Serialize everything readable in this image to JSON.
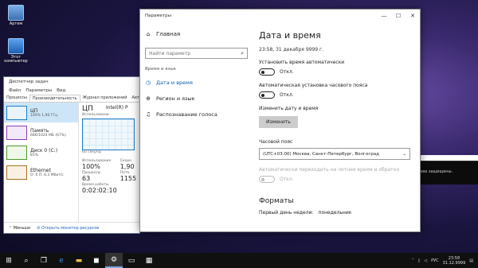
{
  "desktop": {
    "icons": [
      {
        "label": "Артем",
        "icon": "user-folder-icon"
      },
      {
        "label": "Этот компьютер",
        "icon": "computer-icon"
      }
    ]
  },
  "task_manager": {
    "title": "Диспетчер задач",
    "menu": [
      "Файл",
      "Параметры",
      "Вид"
    ],
    "tabs": [
      "Процессы",
      "Производительность",
      "Журнал приложений",
      "Авто"
    ],
    "active_tab": "Производительность",
    "resources": [
      {
        "name": "ЦП",
        "detail": "100% 1,90 ГГц"
      },
      {
        "name": "Память",
        "detail": "686/1024 МБ (67%)"
      },
      {
        "name": "Диск 0 (C:)",
        "detail": "81%"
      },
      {
        "name": "Ethernet",
        "detail": "О: 0 П: 6,3 Мбит/с"
      }
    ],
    "detail": {
      "title": "ЦП",
      "cpu_name": "Intel(R) P",
      "usage_label": "Использовани",
      "graph_time": "60 секунд",
      "stats": [
        {
          "k": "Использование",
          "v": "100%"
        },
        {
          "k": "Скоро",
          "v": "1,90"
        },
        {
          "k": "Процессы",
          "v": "63"
        },
        {
          "k": "Пото",
          "v": "1155"
        },
        {
          "k": "Время работы",
          "v": "0:02:02:10"
        }
      ]
    },
    "footer": {
      "less": "Меньше",
      "monitor": "Открыть монитор ресурсов"
    }
  },
  "settings": {
    "title": "Параметры",
    "nav": {
      "home": "Главная",
      "search_placeholder": "Найти параметр",
      "group": "Время и язык",
      "items": [
        {
          "label": "Дата и время",
          "icon": "clock-icon",
          "active": true
        },
        {
          "label": "Регион и язык",
          "icon": "globe-icon",
          "active": false
        },
        {
          "label": "Распознавание голоса",
          "icon": "microphone-icon",
          "active": false
        }
      ]
    },
    "main": {
      "heading": "Дата и время",
      "current_time": "23:58, 31 декабря 9999 г.",
      "auto_time_label": "Установить время автоматически",
      "auto_time_state": "Откл.",
      "auto_tz_label": "Автоматическая установка часового пояса",
      "auto_tz_state": "Откл.",
      "change_label": "Изменить дату и время",
      "change_button": "Изменить",
      "timezone_label": "Часовой пояс",
      "timezone_value": "(UTC+03:00) Москва, Санкт-Петербург, Волгоград",
      "dst_label": "Автоматически переходить на летнее время и обратно",
      "dst_state": "Откл.",
      "formats_heading": "Форматы",
      "first_day_label": "Первый день недели:",
      "first_day_value": "понедельник"
    }
  },
  "console": {
    "text": "рава защищены."
  },
  "taskbar": {
    "lang": "РУС",
    "time": "23:58",
    "date": "31.12.9999"
  }
}
